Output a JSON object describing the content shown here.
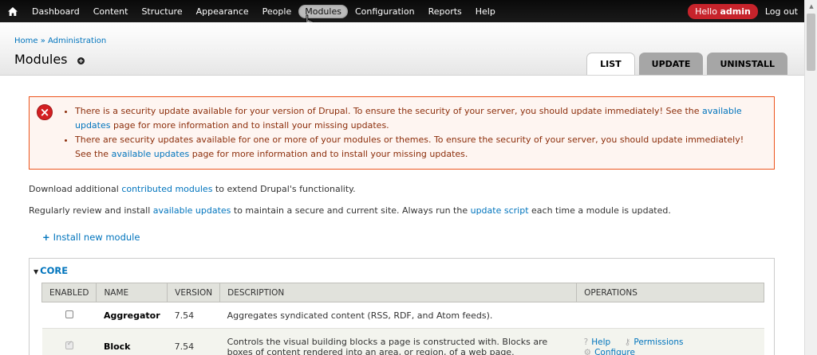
{
  "toolbar": {
    "menu": [
      "Dashboard",
      "Content",
      "Structure",
      "Appearance",
      "People",
      "Modules",
      "Configuration",
      "Reports",
      "Help"
    ],
    "active": "Modules",
    "hello_prefix": "Hello ",
    "user": "admin",
    "logout": "Log out",
    "icons": {
      "home": "home-icon",
      "cursor": "hand-pointer-cursor"
    }
  },
  "header": {
    "breadcrumb": [
      "Home",
      "Administration"
    ],
    "breadcrumb_sep": " » ",
    "title": "Modules",
    "tabs": [
      {
        "label": "List",
        "active": true
      },
      {
        "label": "Update",
        "active": false
      },
      {
        "label": "Uninstall",
        "active": false
      }
    ]
  },
  "messages": {
    "items": [
      {
        "before": "There is a security update available for your version of Drupal. To ensure the security of your server, you should update immediately! See the ",
        "link": "available updates",
        "after": " page for more information and to install your missing updates."
      },
      {
        "before": "There are security updates available for one or more of your modules or themes. To ensure the security of your server, you should update immediately! See the ",
        "link": "available updates",
        "after": " page for more information and to install your missing updates."
      }
    ]
  },
  "intro": {
    "p1_before": "Download additional ",
    "p1_link": "contributed modules",
    "p1_after": " to extend Drupal's functionality.",
    "p2_before": "Regularly review and install ",
    "p2_link1": "available updates",
    "p2_mid": " to maintain a secure and current site. Always run the ",
    "p2_link2": "update script",
    "p2_after": " each time a module is updated.",
    "install": "Install new module"
  },
  "core": {
    "legend": "CORE",
    "columns": [
      "Enabled",
      "Name",
      "Version",
      "Description",
      "Operations"
    ],
    "rows": [
      {
        "enabled": false,
        "name": "Aggregator",
        "version": "7.54",
        "description": "Aggregates syndicated content (RSS, RDF, and Atom feeds).",
        "ops": []
      },
      {
        "enabled": true,
        "name": "Block",
        "version": "7.54",
        "description": "Controls the visual building blocks a page is constructed with. Blocks are boxes of content rendered into an area, or region, of a web page.",
        "ops": [
          "Help",
          "Permissions",
          "Configure"
        ]
      }
    ]
  },
  "colors": {
    "accent": "#0074bd",
    "error_border": "#ed541d",
    "error_bg": "#fef5f1",
    "hello_bg": "#c7232b"
  }
}
